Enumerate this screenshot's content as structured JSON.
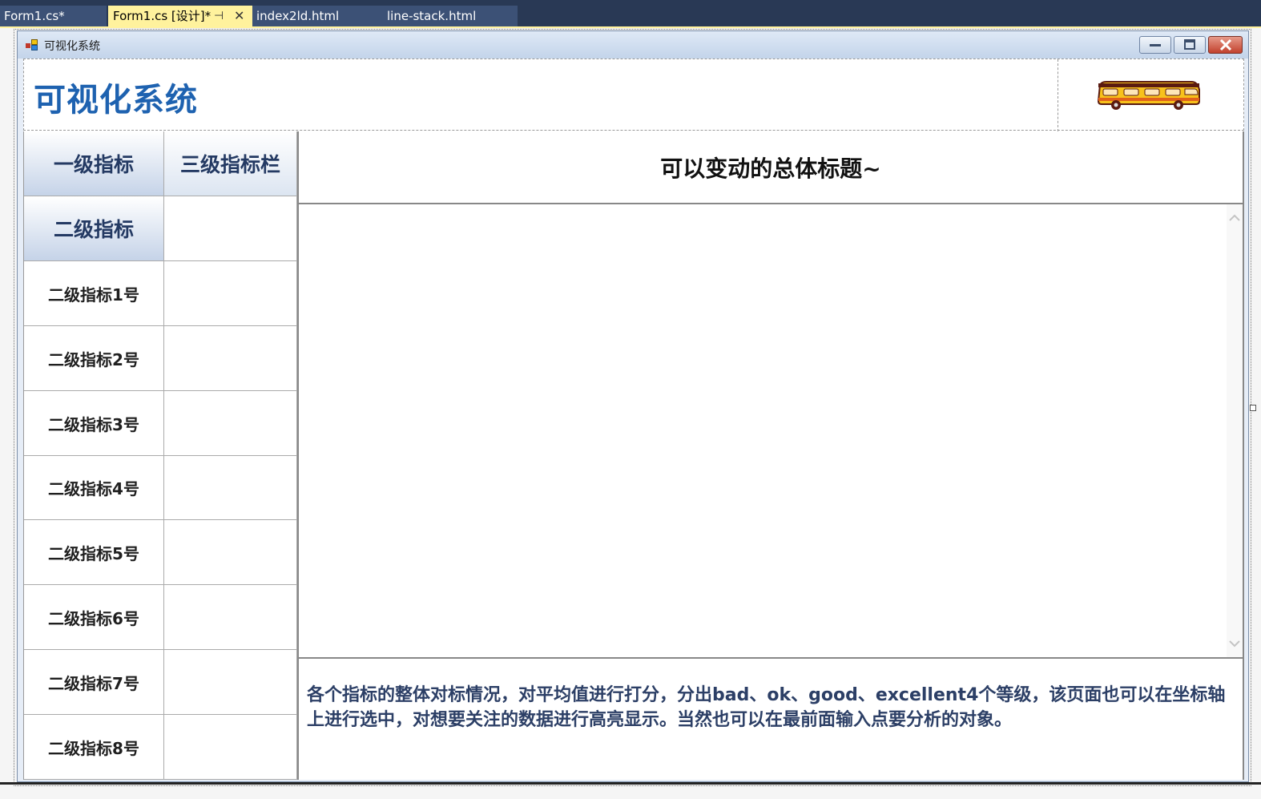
{
  "ide_tabs": [
    {
      "label": "Form1.cs*"
    },
    {
      "label": "Form1.cs [设计]*",
      "pin": "⊣",
      "close": "✕"
    },
    {
      "label": "index2ld.html"
    },
    {
      "label": "line-stack.html"
    }
  ],
  "window": {
    "title": "可视化系统",
    "minimize_icon": "minimize-icon",
    "maximize_icon": "maximize-icon",
    "close_icon": "close-icon"
  },
  "header": {
    "heading": "可视化系统",
    "logo_icon": "bus-icon"
  },
  "grid": {
    "level1_header": "一级指标",
    "level3_header": "三级指标栏",
    "level2_header": "二级指标",
    "rows": [
      {
        "label": "二级指标1号"
      },
      {
        "label": "二级指标2号"
      },
      {
        "label": "二级指标3号"
      },
      {
        "label": "二级指标4号"
      },
      {
        "label": "二级指标5号"
      },
      {
        "label": "二级指标6号"
      },
      {
        "label": "二级指标7号"
      },
      {
        "label": "二级指标8号"
      }
    ]
  },
  "panel": {
    "title": "可以变动的总体标题~",
    "description": "各个指标的整体对标情况，对平均值进行打分，分出bad、ok、good、excellent4个等级，该页面也可以在坐标轴上进行选中，对想要关注的数据进行高亮显示。当然也可以在最前面输入点要分析的对象。"
  },
  "colors": {
    "heading": "#1e62b0",
    "header_cell_text": "#243a63",
    "description_text": "#2c3f66",
    "ide_bar": "#293955",
    "active_tab": "#fff29d"
  }
}
